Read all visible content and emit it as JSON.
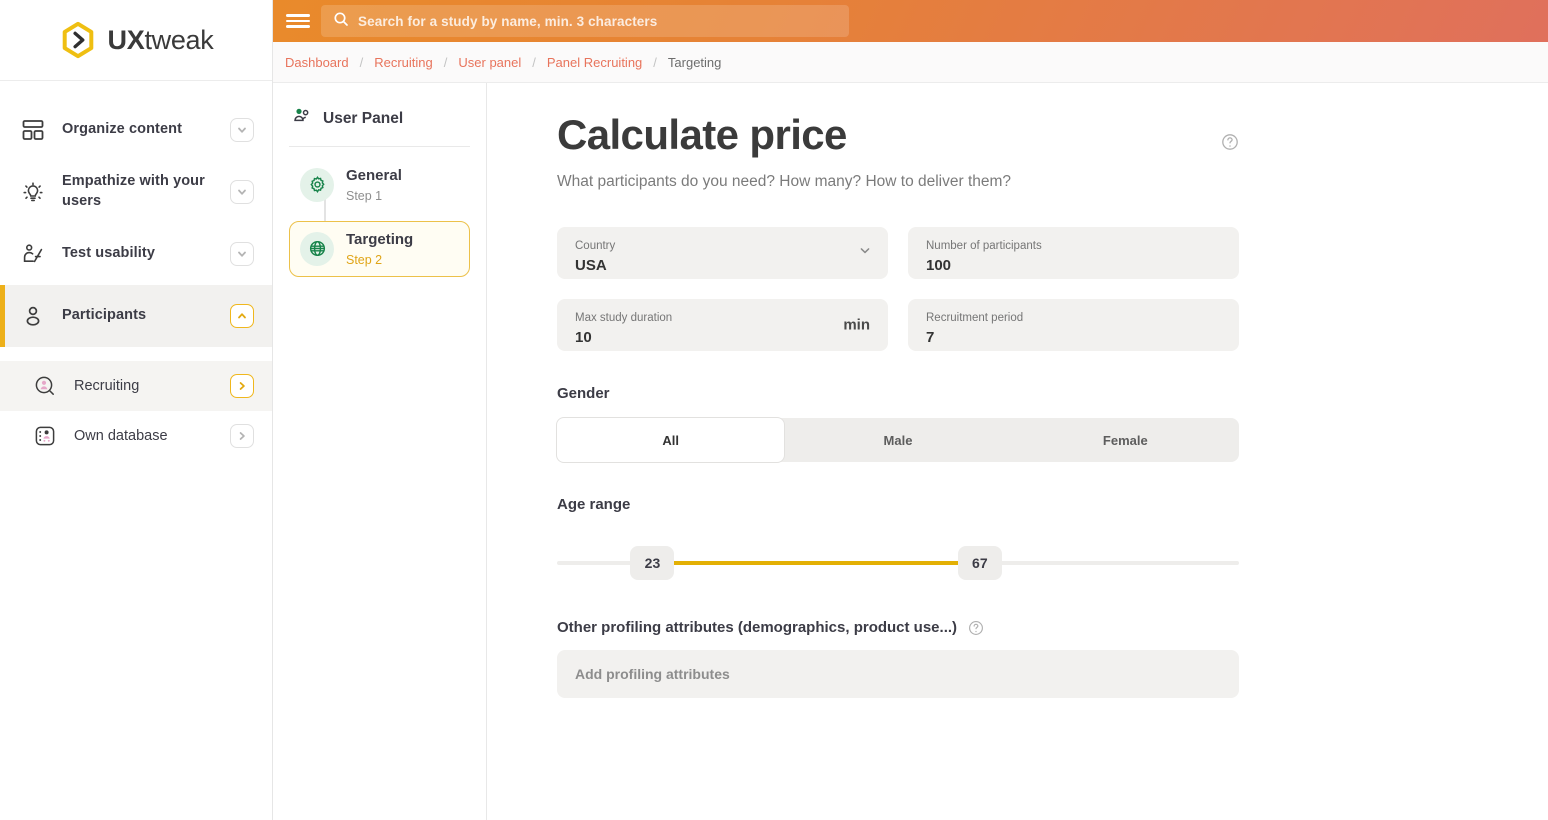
{
  "brand": {
    "name_bold": "UX",
    "name_light": "tweak"
  },
  "topbar": {
    "search_placeholder": "Search for a study by name, min. 3 characters"
  },
  "breadcrumb": {
    "items": [
      "Dashboard",
      "Recruiting",
      "User panel",
      "Panel Recruiting",
      "Targeting"
    ]
  },
  "sidebar": {
    "items": [
      {
        "label": "Organize content",
        "icon": "layout-icon",
        "chevron": "chevron-down-icon",
        "chevron_style": "plain",
        "active": false
      },
      {
        "label": "Empathize with your users",
        "icon": "lightbulb-icon",
        "chevron": "chevron-down-icon",
        "chevron_style": "plain",
        "active": false
      },
      {
        "label": "Test usability",
        "icon": "person-at-desk-icon",
        "chevron": "chevron-down-icon",
        "chevron_style": "plain",
        "active": false
      },
      {
        "label": "Participants",
        "icon": "user-icon",
        "chevron": "chevron-up-icon",
        "chevron_style": "gold",
        "active": true
      }
    ],
    "sub_items": [
      {
        "label": "Recruiting",
        "icon": "user-search-icon",
        "chevron": "chevron-right-icon",
        "chevron_style": "gold",
        "shaded": true
      },
      {
        "label": "Own database",
        "icon": "database-people-icon",
        "chevron": "chevron-right-icon",
        "chevron_style": "plain",
        "shaded": false
      }
    ]
  },
  "steps": {
    "panel_title": "User Panel",
    "items": [
      {
        "name": "General",
        "sub": "Step 1",
        "icon": "gear-icon",
        "current": false
      },
      {
        "name": "Targeting",
        "sub": "Step 2",
        "icon": "globe-icon",
        "current": true
      }
    ]
  },
  "main": {
    "title": "Calculate price",
    "subtitle": "What participants do you need? How many? How to deliver them?",
    "fields": [
      {
        "label": "Country",
        "value": "USA",
        "control": "select"
      },
      {
        "label": "Number of participants",
        "value": "100",
        "control": "number"
      },
      {
        "label": "Max study duration",
        "value": "10",
        "suffix": "min",
        "control": "number"
      },
      {
        "label": "Recruitment period",
        "value": "7",
        "control": "number"
      }
    ],
    "gender": {
      "label": "Gender",
      "options": [
        "All",
        "Male",
        "Female"
      ],
      "selected": "All"
    },
    "age_range": {
      "label": "Age range",
      "min_value": "23",
      "max_value": "67",
      "min_pct": 14,
      "max_pct": 62
    },
    "profiling": {
      "label": "Other profiling attributes (demographics, product use...)",
      "placeholder": "Add profiling attributes"
    }
  },
  "colors": {
    "accent_gold": "#edb01a",
    "header_start": "#e98a2b",
    "header_end": "#e0705c",
    "crumb_link": "#e8745c",
    "step_green": "#17834a"
  }
}
